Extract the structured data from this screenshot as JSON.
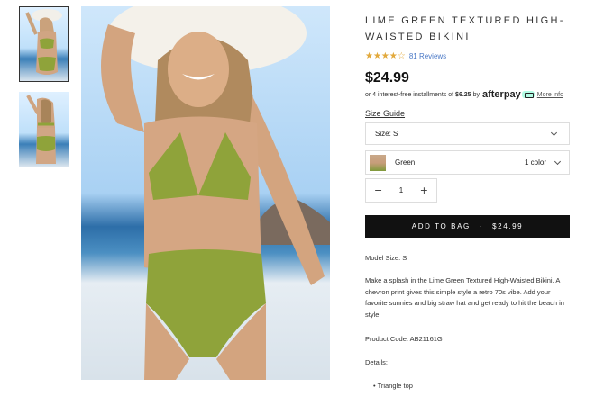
{
  "gallery": {
    "thumbnails": [
      "thumbnail-1",
      "thumbnail-2"
    ],
    "main_image": "main-product-photo"
  },
  "product": {
    "title": "LIME GREEN TEXTURED HIGH-WAISTED BIKINI",
    "rating_stars": "★★★★☆",
    "rating_value": 4.5,
    "reviews": "81 Reviews",
    "price": "$24.99",
    "installments_prefix": "or 4 interest-free installments of",
    "installment_amount": "$6.25",
    "installments_by": "by",
    "afterpay_label": "afterpay",
    "more_info": "More info",
    "size_guide": "Size Guide",
    "size_select": "Size: S",
    "color_name": "Green",
    "color_count": "1 color",
    "quantity": "1",
    "qty_minus": "−",
    "qty_plus": "+",
    "add_to_bag": "ADD TO BAG",
    "add_to_bag_sep": "·",
    "add_to_bag_price": "$24.99",
    "model_size": "Model Size: S",
    "description": "Make a splash in the Lime Green Textured High-Waisted Bikini. A chevron print gives this simple style a retro 70s vibe. Add your favorite sunnies and big straw hat and get ready to hit the beach in style.",
    "product_code": "Product Code: AB21161G",
    "details_label": "Details:",
    "details_items": [
      "Triangle top"
    ]
  },
  "colors": {
    "accent_star": "#e2a93c",
    "link": "#4a78c6",
    "button_bg": "#111111",
    "afterpay_mint": "#b2fce4",
    "bikini_green": "#8fa33a"
  }
}
